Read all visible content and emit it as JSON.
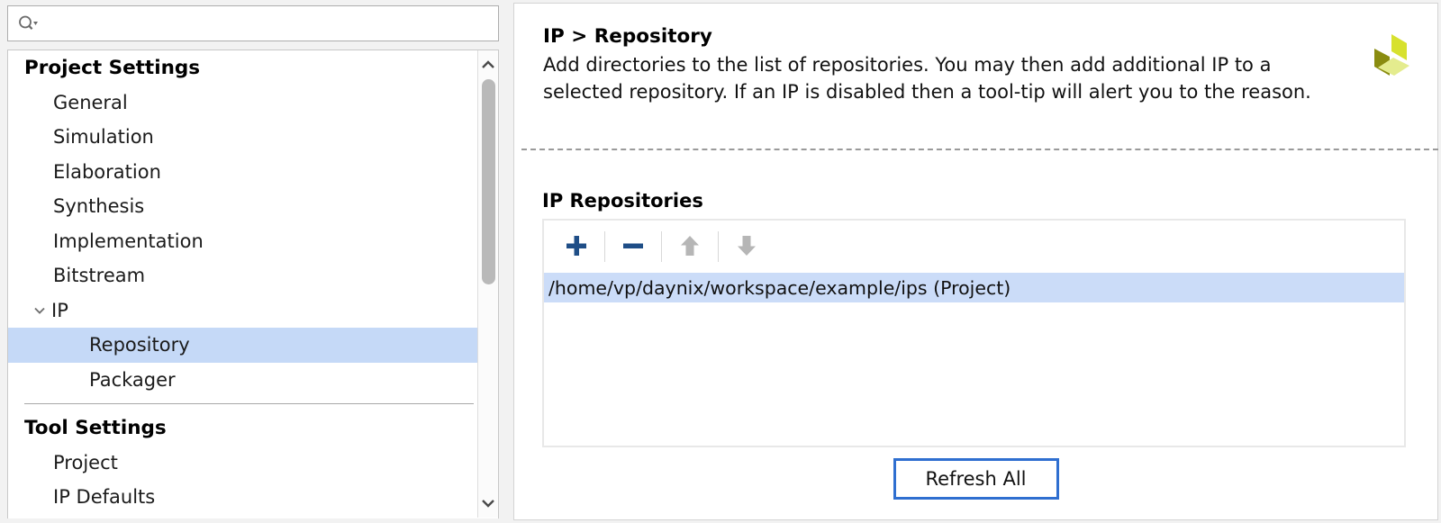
{
  "sidebar": {
    "search": {
      "icon": "search-icon",
      "value": "",
      "placeholder": ""
    },
    "tree": [
      {
        "label": "Project Settings",
        "type": "group"
      },
      {
        "label": "General",
        "type": "child"
      },
      {
        "label": "Simulation",
        "type": "child"
      },
      {
        "label": "Elaboration",
        "type": "child"
      },
      {
        "label": "Synthesis",
        "type": "child"
      },
      {
        "label": "Implementation",
        "type": "child"
      },
      {
        "label": "Bitstream",
        "type": "child"
      },
      {
        "label": "IP",
        "type": "expandable",
        "expanded": true,
        "icon": "chevron-down-icon"
      },
      {
        "label": "Repository",
        "type": "child2",
        "selected": true
      },
      {
        "label": "Packager",
        "type": "child2"
      },
      {
        "label": "",
        "type": "separator"
      },
      {
        "label": "Tool Settings",
        "type": "group"
      },
      {
        "label": "Project",
        "type": "child"
      },
      {
        "label": "IP Defaults",
        "type": "child"
      }
    ],
    "scrollbar": {
      "up_icon": "chevron-up-icon",
      "down_icon": "chevron-down-icon"
    }
  },
  "main": {
    "description": {
      "title": "IP > Repository",
      "body": "Add directories to the list of repositories. You may then add additional IP to a selected repository. If an IP is disabled then a tool-tip will alert you to the reason.",
      "logo": "vivado-ip-logo-icon"
    },
    "section": {
      "title": "IP Repositories",
      "toolbar": [
        {
          "name": "add-button",
          "icon": "plus-icon",
          "enabled": true
        },
        {
          "name": "remove-button",
          "icon": "minus-icon",
          "enabled": true
        },
        {
          "name": "move-up-button",
          "icon": "arrow-up-icon",
          "enabled": false
        },
        {
          "name": "move-down-button",
          "icon": "arrow-down-icon",
          "enabled": false
        }
      ],
      "rows": [
        {
          "path": "/home/vp/daynix/workspace/example/ips (Project)",
          "selected": true
        }
      ]
    },
    "refresh_label": "Refresh All"
  },
  "colors": {
    "selection_blue": "#cbdcf8",
    "tree_selection_blue": "#c5d9f7",
    "toolbar_blue": "#1f4e87",
    "toolbar_disabled_gray": "#b6b6b6",
    "focus_border_blue": "#2f6fd0",
    "logo_bright": "#d7e12e",
    "logo_dark": "#8a8c10",
    "logo_pale": "#e4ec8e"
  }
}
